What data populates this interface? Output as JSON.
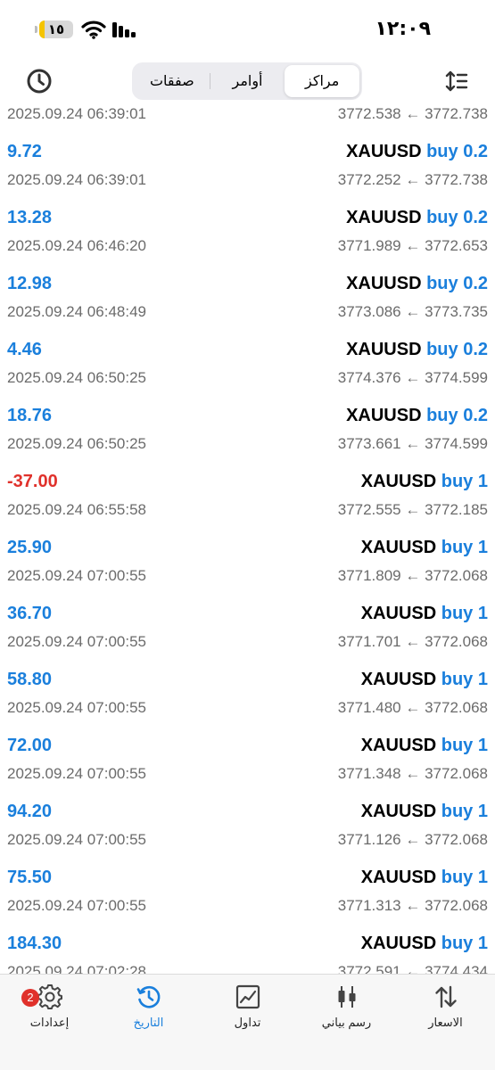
{
  "status_bar": {
    "time": "١٢:٠٩",
    "battery": "١٥",
    "battery_level": 0.15
  },
  "header": {
    "segments": [
      {
        "label": "مراكز",
        "active": true
      },
      {
        "label": "أوامر",
        "active": false
      },
      {
        "label": "صفقات",
        "active": false
      }
    ]
  },
  "top_partial_row": {
    "time": "2025.09.24 06:39:01",
    "prices": "3772.538 ← 3772.738"
  },
  "rows": [
    {
      "symbol": "XAUUSD",
      "side": "buy 0.2",
      "profit": "9.72",
      "time": "2025.09.24 06:39:01",
      "prices": "3772.252 ← 3772.738"
    },
    {
      "symbol": "XAUUSD",
      "side": "buy 0.2",
      "profit": "13.28",
      "time": "2025.09.24 06:46:20",
      "prices": "3771.989 ← 3772.653"
    },
    {
      "symbol": "XAUUSD",
      "side": "buy 0.2",
      "profit": "12.98",
      "time": "2025.09.24 06:48:49",
      "prices": "3773.086 ← 3773.735"
    },
    {
      "symbol": "XAUUSD",
      "side": "buy 0.2",
      "profit": "4.46",
      "time": "2025.09.24 06:50:25",
      "prices": "3774.376 ← 3774.599"
    },
    {
      "symbol": "XAUUSD",
      "side": "buy 0.2",
      "profit": "18.76",
      "time": "2025.09.24 06:50:25",
      "prices": "3773.661 ← 3774.599"
    },
    {
      "symbol": "XAUUSD",
      "side": "buy 1",
      "profit": "-37.00",
      "time": "2025.09.24 06:55:58",
      "prices": "3772.555 ← 3772.185"
    },
    {
      "symbol": "XAUUSD",
      "side": "buy 1",
      "profit": "25.90",
      "time": "2025.09.24 07:00:55",
      "prices": "3771.809 ← 3772.068"
    },
    {
      "symbol": "XAUUSD",
      "side": "buy 1",
      "profit": "36.70",
      "time": "2025.09.24 07:00:55",
      "prices": "3771.701 ← 3772.068"
    },
    {
      "symbol": "XAUUSD",
      "side": "buy 1",
      "profit": "58.80",
      "time": "2025.09.24 07:00:55",
      "prices": "3771.480 ← 3772.068"
    },
    {
      "symbol": "XAUUSD",
      "side": "buy 1",
      "profit": "72.00",
      "time": "2025.09.24 07:00:55",
      "prices": "3771.348 ← 3772.068"
    },
    {
      "symbol": "XAUUSD",
      "side": "buy 1",
      "profit": "94.20",
      "time": "2025.09.24 07:00:55",
      "prices": "3771.126 ← 3772.068"
    },
    {
      "symbol": "XAUUSD",
      "side": "buy 1",
      "profit": "75.50",
      "time": "2025.09.24 07:00:55",
      "prices": "3771.313 ← 3772.068"
    },
    {
      "symbol": "XAUUSD",
      "side": "buy 1",
      "profit": "184.30",
      "time": "2025.09.24 07:02:28",
      "prices": "3772.591 ← 3774.434"
    }
  ],
  "tabbar": {
    "settings": {
      "label": "إعدادات",
      "icon": "gear-icon",
      "badge": "2"
    },
    "history": {
      "label": "التاريخ",
      "icon": "history-icon",
      "active": true
    },
    "trade": {
      "label": "تداول",
      "icon": "trade-chart-icon"
    },
    "chart": {
      "label": "رسم بياني",
      "icon": "candlestick-icon"
    },
    "quotes": {
      "label": "الاسعار",
      "icon": "updown-arrows-icon"
    }
  },
  "colors": {
    "accent": "#1a7fdc",
    "negative": "#e0312b",
    "muted_text": "#6b6b6b"
  }
}
